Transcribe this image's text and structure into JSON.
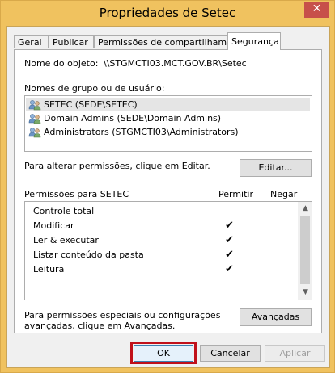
{
  "window": {
    "title": "Propriedades de Setec",
    "close_glyph": "✕"
  },
  "tabs": [
    {
      "label": "Geral",
      "active": false
    },
    {
      "label": "Publicar",
      "active": false
    },
    {
      "label": "Permissões de compartilhamento",
      "active": false
    },
    {
      "label": "Segurança",
      "active": true
    }
  ],
  "security": {
    "object_label": "Nome do objeto:",
    "object_value": "\\\\STGMCTI03.MCT.GOV.BR\\Setec",
    "groups_label": "Nomes de grupo ou de usuário:",
    "users": [
      {
        "name": "SETEC (SEDE\\SETEC)",
        "selected": true,
        "icon": "users-group-icon"
      },
      {
        "name": "Domain Admins (SEDE\\Domain Admins)",
        "selected": false,
        "icon": "users-group-icon"
      },
      {
        "name": "Administrators (STGMCTI03\\Administrators)",
        "selected": false,
        "icon": "users-group-icon"
      }
    ],
    "edit_hint": "Para alterar permissões, clique em Editar.",
    "edit_button": "Editar...",
    "perms_header": "Permissões para SETEC",
    "allow_header": "Permitir",
    "deny_header": "Negar",
    "permissions": [
      {
        "name": "Controle total",
        "allow": ""
      },
      {
        "name": "Modificar",
        "allow": "✔"
      },
      {
        "name": "Ler & executar",
        "allow": "✔"
      },
      {
        "name": "Listar conteúdo da pasta",
        "allow": "✔"
      },
      {
        "name": "Leitura",
        "allow": "✔"
      }
    ],
    "special_hint_line1": "Para permissões especiais ou configurações",
    "special_hint_line2": "avançadas, clique em Avançadas.",
    "advanced_button": "Avançadas"
  },
  "footer": {
    "ok_label": "OK",
    "cancel_label": "Cancelar",
    "apply_label": "Aplicar"
  },
  "colors": {
    "frame": "#f0c25f",
    "highlight": "#c0101a",
    "selected_row": "#e5e5e5"
  }
}
